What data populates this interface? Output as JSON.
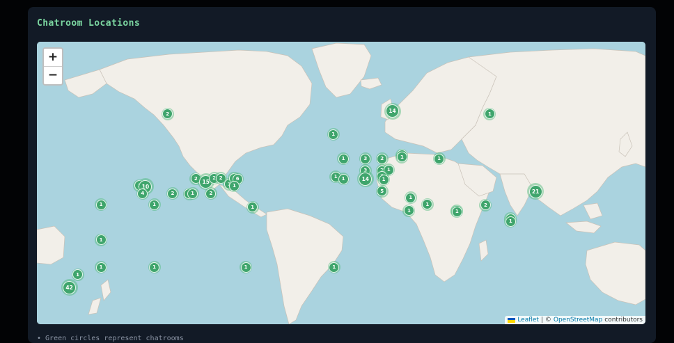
{
  "panel": {
    "title": "Chatroom Locations"
  },
  "map": {
    "zoom_in_label": "+",
    "zoom_out_label": "−",
    "attribution": {
      "leaflet": "Leaflet",
      "separator": "| ©",
      "osm": "OpenStreetMap",
      "suffix": "contributors"
    },
    "clusters": [
      {
        "count": 2,
        "lon": -110.5,
        "lat": 63.8
      },
      {
        "count": 14,
        "lon": 24.5,
        "lat": 64.8
      },
      {
        "count": 1,
        "lon": 83,
        "lat": 63.8
      },
      {
        "count": 1,
        "lon": -11.0,
        "lat": 55.8
      },
      {
        "count": 1,
        "lon": -5.0,
        "lat": 43.8
      },
      {
        "count": 3,
        "lon": 8.3,
        "lat": 43.8
      },
      {
        "count": 2,
        "lon": 18.3,
        "lat": 43.8
      },
      {
        "count": 1,
        "lon": 30.3,
        "lat": 45.8
      },
      {
        "count": 1,
        "lon": 30.3,
        "lat": 44.8
      },
      {
        "count": 1,
        "lon": 52.5,
        "lat": 43.8
      },
      {
        "count": 3,
        "lon": 8.3,
        "lat": 36.8
      },
      {
        "count": 7,
        "lon": 18.3,
        "lat": 36.8
      },
      {
        "count": 1,
        "lon": 22.3,
        "lat": 37.3
      },
      {
        "count": 1,
        "lon": -9.5,
        "lat": 32.8
      },
      {
        "count": 1,
        "lon": -5.0,
        "lat": 31.3
      },
      {
        "count": 14,
        "lon": 8.3,
        "lat": 31.3
      },
      {
        "count": 2,
        "lon": 18.3,
        "lat": 33.3
      },
      {
        "count": 1,
        "lon": 19.3,
        "lat": 31.0
      },
      {
        "count": 5,
        "lon": 18.3,
        "lat": 23.0
      },
      {
        "count": 1,
        "lon": 35.5,
        "lat": 18.3
      },
      {
        "count": 21,
        "lon": 110.5,
        "lat": 22.8
      },
      {
        "count": 1,
        "lon": 45.5,
        "lat": 13.3
      },
      {
        "count": 1,
        "lon": 34.5,
        "lat": 8.6
      },
      {
        "count": 2,
        "lon": 80.5,
        "lat": 12.8
      },
      {
        "count": 1,
        "lon": 63.3,
        "lat": 8.6
      },
      {
        "count": 1,
        "lon": 63.3,
        "lat": 7.8
      },
      {
        "count": 1,
        "lon": 95.5,
        "lat": 2.4
      },
      {
        "count": 1,
        "lon": 95.5,
        "lat": 0.3
      },
      {
        "count": 2,
        "lon": -93.5,
        "lat": 31.7
      },
      {
        "count": 15,
        "lon": -87.5,
        "lat": 29.6
      },
      {
        "count": 2,
        "lon": -82.5,
        "lat": 31.8
      },
      {
        "count": 2,
        "lon": -78.5,
        "lat": 31.8
      },
      {
        "count": 1,
        "lon": -73.5,
        "lat": 27.8
      },
      {
        "count": 1,
        "lon": -70.5,
        "lat": 31.8
      },
      {
        "count": 6,
        "lon": -68.5,
        "lat": 31.4
      },
      {
        "count": 1,
        "lon": -70.5,
        "lat": 26.8
      },
      {
        "count": 1,
        "lon": -127.5,
        "lat": 27.0
      },
      {
        "count": 10,
        "lon": -123.8,
        "lat": 26.2
      },
      {
        "count": 4,
        "lon": -125.5,
        "lat": 21.3
      },
      {
        "count": 2,
        "lon": -107.5,
        "lat": 21.3
      },
      {
        "count": 1,
        "lon": -97.5,
        "lat": 21.0
      },
      {
        "count": 1,
        "lon": -95.5,
        "lat": 21.3
      },
      {
        "count": 2,
        "lon": -84.5,
        "lat": 21.3
      },
      {
        "count": 1,
        "lon": -118.5,
        "lat": 13.0
      },
      {
        "count": 1,
        "lon": -150.5,
        "lat": 13.0
      },
      {
        "count": 1,
        "lon": -59.5,
        "lat": 11.3
      },
      {
        "count": 1,
        "lon": -150.5,
        "lat": -14.0
      },
      {
        "count": 1,
        "lon": -150.5,
        "lat": -33.3
      },
      {
        "count": 1,
        "lon": -118.5,
        "lat": -33.3
      },
      {
        "count": 1,
        "lon": -63.5,
        "lat": -33.3
      },
      {
        "count": 1,
        "lon": -10.5,
        "lat": -33.3
      },
      {
        "count": 1,
        "lon": -164.5,
        "lat": -38.0
      },
      {
        "count": 42,
        "lon": -169.5,
        "lat": -45.5
      }
    ]
  },
  "legend": {
    "text": "• Green circles represent chatrooms"
  },
  "colors": {
    "water": "#aad3df",
    "land": "#f2efe9",
    "cluster": "#3fa56c",
    "title": "#7bd5a0"
  }
}
